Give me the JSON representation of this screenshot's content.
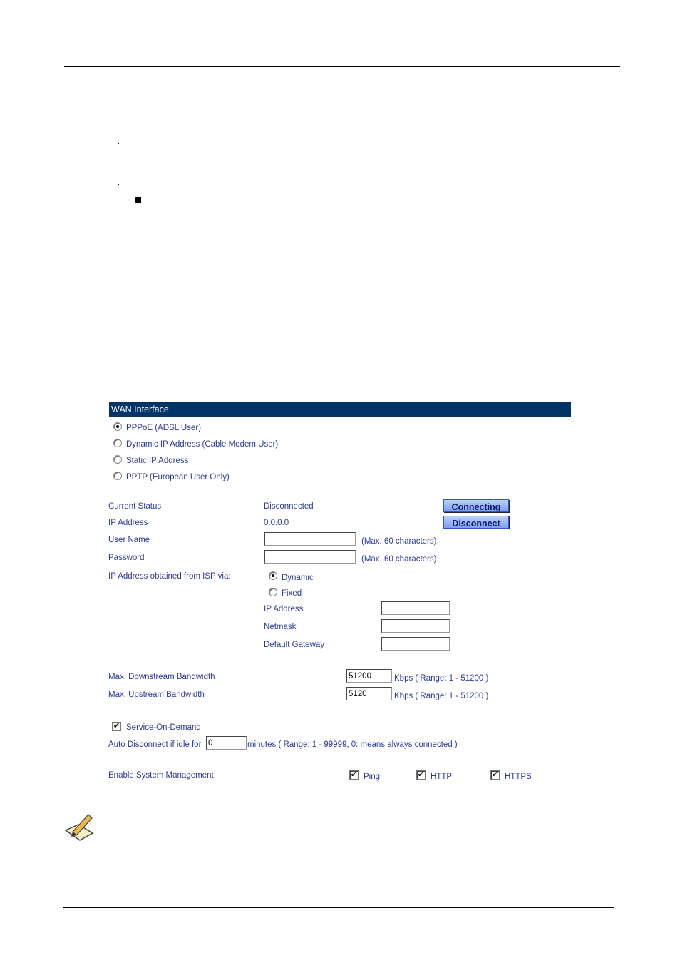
{
  "wan": {
    "title": "WAN Interface",
    "modes": [
      {
        "label": "PPPoE (ADSL User)",
        "selected": true
      },
      {
        "label": "Dynamic IP Address (Cable Modem User)",
        "selected": false
      },
      {
        "label": "Static IP Address",
        "selected": false
      },
      {
        "label": "PPTP (European User Only)",
        "selected": false
      }
    ],
    "current_status_label": "Current Status",
    "current_status_value": "Disconnected",
    "ip_address_label": "IP Address",
    "ip_address_value": "0.0.0.0",
    "connecting_button": "Connecting",
    "disconnect_button": "Disconnect",
    "user_name_label": "User Name",
    "user_name_value": "",
    "user_name_hint": "(Max. 60 characters)",
    "password_label": "Password",
    "password_value": "",
    "password_hint": "(Max. 60 characters)",
    "isp_via_label": "IP Address obtained from ISP via:",
    "isp_dynamic": {
      "label": "Dynamic",
      "selected": true
    },
    "isp_fixed": {
      "label": "Fixed",
      "selected": false
    },
    "fixed_ip_label": "IP Address",
    "netmask_label": "Netmask",
    "gateway_label": "Default Gateway",
    "downstream_label": "Max. Downstream Bandwidth",
    "downstream_value": "51200",
    "downstream_hint": "Kbps  ( Range: 1 - 51200 )",
    "upstream_label": "Max. Upstream Bandwidth",
    "upstream_value": "5120",
    "upstream_hint": "Kbps  ( Range: 1 - 51200 )",
    "service_on_demand": {
      "label": "Service-On-Demand",
      "checked": true
    },
    "auto_disconnect_label": "Auto Disconnect if idle for",
    "auto_disconnect_value": "0",
    "auto_disconnect_hint": "minutes ( Range: 1 - 99999, 0: means always connected )",
    "system_mgmt_label": "Enable System Management",
    "mgmt": [
      {
        "label": "Ping",
        "checked": true
      },
      {
        "label": "HTTP",
        "checked": true
      },
      {
        "label": "HTTPS",
        "checked": true
      }
    ]
  },
  "icons": {
    "note": "pencil-note-icon"
  }
}
